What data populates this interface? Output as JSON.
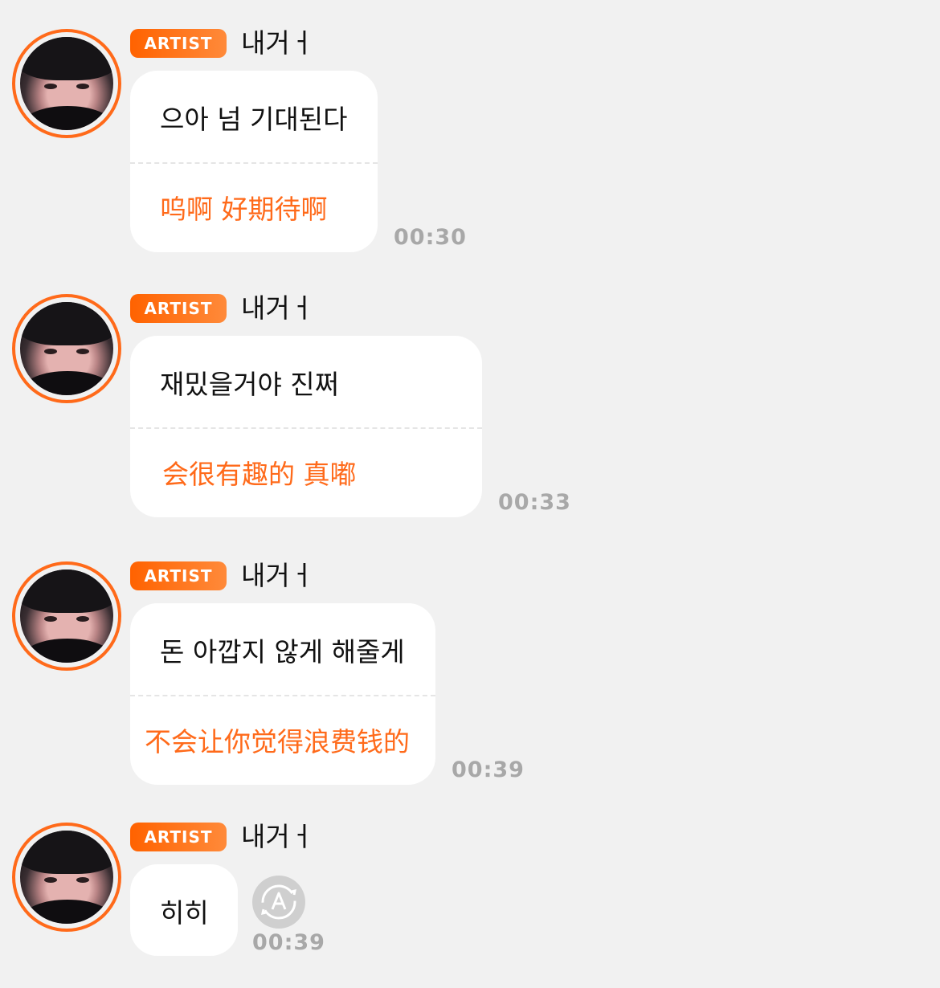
{
  "messages": [
    {
      "badge": "ARTIST",
      "sender": "내거ㅓ",
      "korean": "으아 넘 기대된다",
      "chinese": "呜啊 好期待啊",
      "time": "00:30"
    },
    {
      "badge": "ARTIST",
      "sender": "내거ㅓ",
      "korean": "재밌을거야 진쩌",
      "chinese": "会很有趣的 真嘟",
      "time": "00:33"
    },
    {
      "badge": "ARTIST",
      "sender": "내거ㅓ",
      "korean": "돈 아깝지 않게 해줄게",
      "chinese": "不会让你觉得浪费钱的",
      "time": "00:39"
    },
    {
      "badge": "ARTIST",
      "sender": "내거ㅓ",
      "korean": "히히",
      "time": "00:39",
      "status_icon": "auto-translate-icon"
    }
  ],
  "colors": {
    "accent": "#ff6a1a",
    "background": "#f1f1f1",
    "bubble": "#ffffff",
    "timestamp": "#a8a8a8"
  }
}
